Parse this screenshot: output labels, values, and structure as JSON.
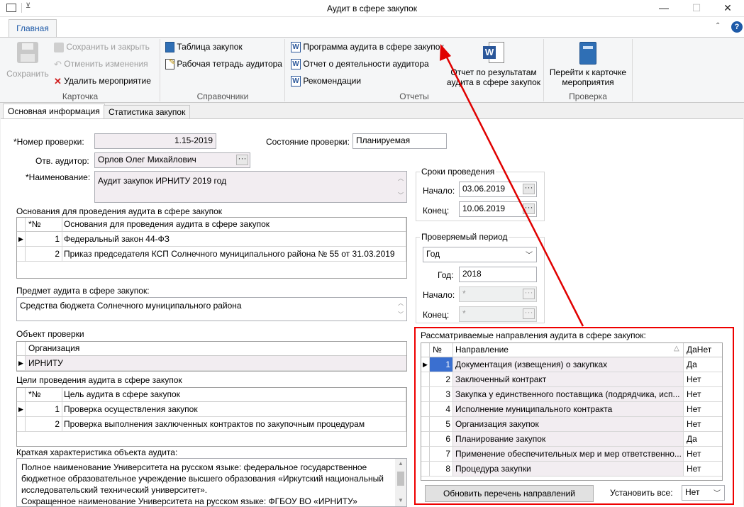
{
  "window": {
    "title": "Аудит в сфере закупок",
    "minimize": "—",
    "maximize": "☐",
    "close": "✕"
  },
  "ribbon": {
    "tab": "Главная",
    "help": "?",
    "save": "Сохранить",
    "save_close": "Сохранить и закрыть",
    "cancel_changes": "Отменить изменения",
    "delete_event": "Удалить мероприятие",
    "group_card": "Карточка",
    "table_purchases": "Таблица закупок",
    "auditor_workbook": "Рабочая тетрадь аудитора",
    "group_refs": "Справочники",
    "audit_program": "Программа аудита в сфере закупок",
    "activity_report": "Отчет о деятельности аудитора",
    "recommendations": "Рекомендации",
    "results_report": "Отчет по результатам аудита в сфере закупок",
    "group_reports": "Отчеты",
    "goto_card": "Перейти к карточке мероприятия",
    "group_check": "Проверка"
  },
  "tabs": {
    "main": "Основная информация",
    "stats": "Статистика закупок"
  },
  "form": {
    "number_label": "*Номер проверки:",
    "number_value": "1.15-2019",
    "state_label": "Состояние проверки:",
    "state_value": "Планируемая",
    "auditor_label": "Отв. аудитор:",
    "auditor_value": "Орлов Олег Михайлович",
    "name_label": "*Наименование:",
    "name_value": "Аудит закупок ИРНИТУ 2019 год",
    "basis_title": "Основания для проведения аудита в сфере закупок",
    "basis_headers": [
      "*№",
      "Основания для проведения аудита в сфере закупок"
    ],
    "basis_rows": [
      {
        "n": "1",
        "text": "Федеральный закон 44-ФЗ"
      },
      {
        "n": "2",
        "text": "Приказ председателя КСП Солнечного муниципального района № 55 от 31.03.2019"
      }
    ],
    "subject_title": "Предмет аудита в сфере закупок:",
    "subject_value": "Средства бюджета Солнечного муниципального района",
    "object_title": "Объект проверки",
    "object_header": "Организация",
    "object_value": "ИРНИТУ",
    "goals_title": "Цели проведения аудита в сфере закупок",
    "goals_headers": [
      "*№",
      "Цель аудита в сфере закупок"
    ],
    "goals_rows": [
      {
        "n": "1",
        "text": "Проверка осуществления закупок"
      },
      {
        "n": "2",
        "text": "Проверка выполнения заключенных контрактов по закупочным процедурам"
      }
    ],
    "brief_title": "Краткая характеристика объекта аудита:",
    "brief_lines": [
      "Полное наименование Университета на русском языке: федеральное государственное",
      "бюджетное образовательное учреждение высшего образования «Иркутский национальный",
      "исследовательский технический университет».",
      "Сокращенное наименование Университета на русском языке: ФГБОУ ВО «ИРНИТУ»"
    ],
    "dates_title": "Сроки проведения",
    "start_label": "Начало:",
    "start_value": "03.06.2019",
    "end_label": "Конец:",
    "end_value": "10.06.2019",
    "period_title": "Проверяемый период",
    "period_type": "Год",
    "year_label": "Год:",
    "year_value": "2018",
    "pstart_label": "Начало:",
    "pstart_value": "*",
    "pend_label": "Конец:",
    "pend_value": "*",
    "directions_title": "Рассматриваемые направления аудита в сфере закупок:",
    "directions_headers": {
      "n": "№",
      "dir": "Направление",
      "sort": "△",
      "yn": "ДаНет"
    },
    "directions_rows": [
      {
        "n": "1",
        "text": "Документация (извещения) о закупках",
        "yn": "Да"
      },
      {
        "n": "2",
        "text": "Заключенный контракт",
        "yn": "Нет"
      },
      {
        "n": "3",
        "text": "Закупка у единственного поставщика (подрядчика, исп...",
        "yn": "Нет"
      },
      {
        "n": "4",
        "text": "Исполнение муниципального контракта",
        "yn": "Нет"
      },
      {
        "n": "5",
        "text": "Организация закупок",
        "yn": "Нет"
      },
      {
        "n": "6",
        "text": "Планирование закупок",
        "yn": "Да"
      },
      {
        "n": "7",
        "text": "Применение обеспечительных мер и мер ответственно...",
        "yn": "Нет"
      },
      {
        "n": "8",
        "text": "Процедура закупки",
        "yn": "Нет"
      }
    ],
    "refresh_button": "Обновить перечень направлений",
    "set_all_label": "Установить все:",
    "set_all_value": "Нет"
  },
  "colors": {
    "accent": "#1e5aa8",
    "annotation": "#e00000",
    "selected_row": "#3a6fd0"
  }
}
